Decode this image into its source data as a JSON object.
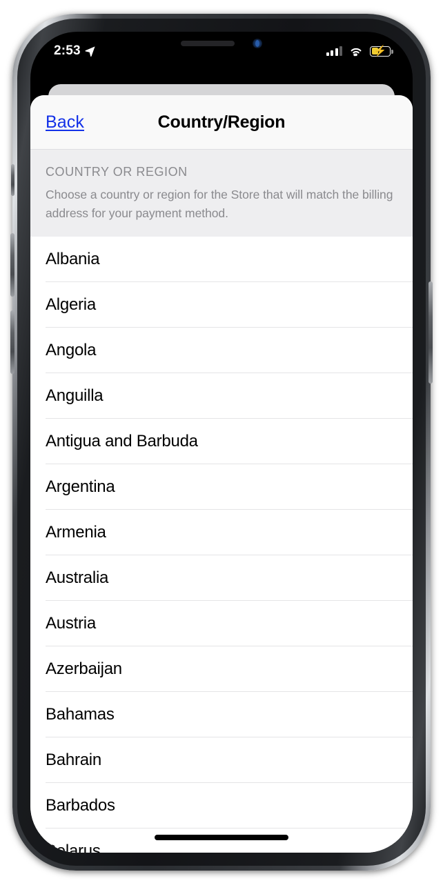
{
  "status_bar": {
    "time": "2:53",
    "location_icon": "location-arrow-icon",
    "cellular_icon": "cellular-signal-icon",
    "wifi_icon": "wifi-icon",
    "battery_icon": "battery-charging-icon",
    "battery_color": "#fdd835",
    "charging_glyph": "⚡"
  },
  "nav": {
    "back_label": "Back",
    "title": "Country/Region",
    "back_color": "#1331e8"
  },
  "section": {
    "title": "COUNTRY OR REGION",
    "description": "Choose a country or region for the Store that will match the billing address for your payment method."
  },
  "countries": [
    {
      "name": "Albania"
    },
    {
      "name": "Algeria"
    },
    {
      "name": "Angola"
    },
    {
      "name": "Anguilla"
    },
    {
      "name": "Antigua and Barbuda"
    },
    {
      "name": "Argentina"
    },
    {
      "name": "Armenia"
    },
    {
      "name": "Australia"
    },
    {
      "name": "Austria"
    },
    {
      "name": "Azerbaijan"
    },
    {
      "name": "Bahamas"
    },
    {
      "name": "Bahrain"
    },
    {
      "name": "Barbados"
    },
    {
      "name": "Belarus"
    }
  ]
}
